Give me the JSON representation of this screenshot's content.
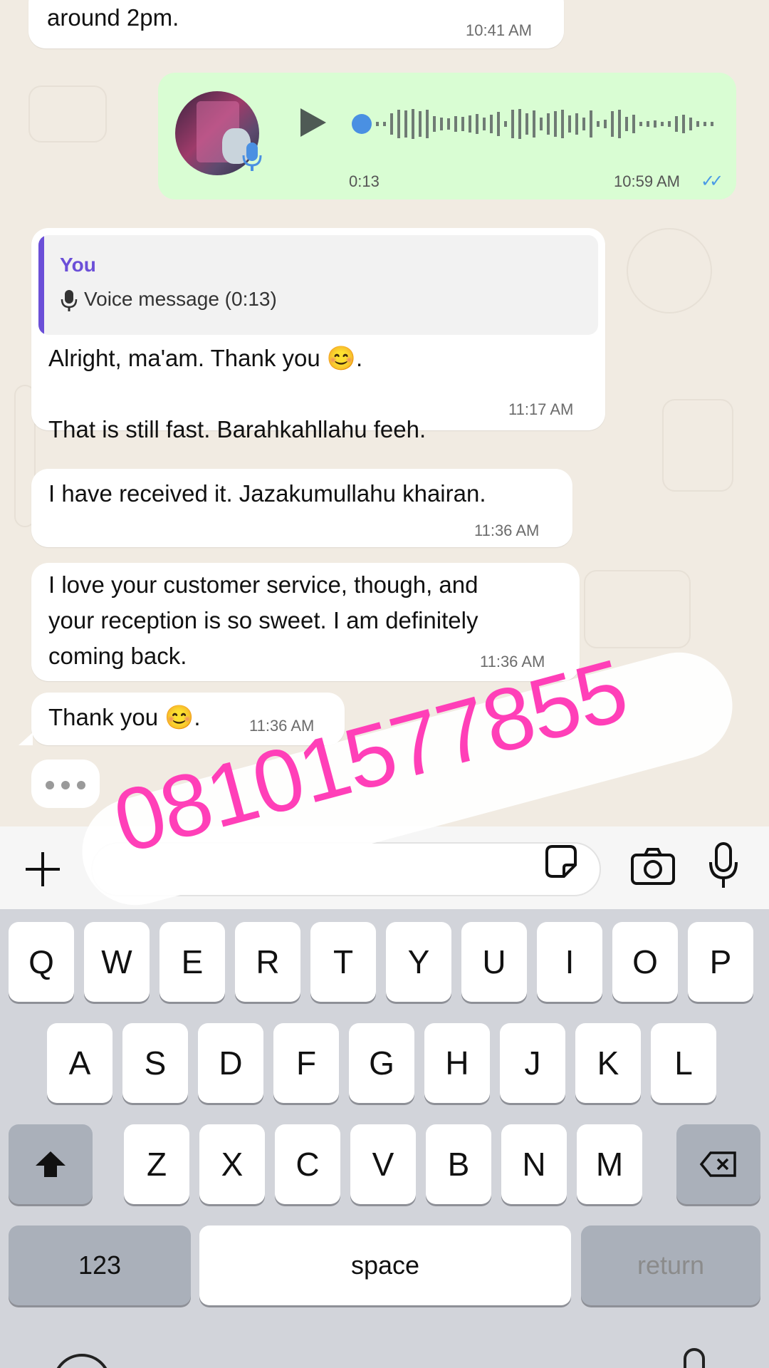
{
  "messages": {
    "m0": {
      "text": "around 2pm.",
      "time": "10:41 AM"
    },
    "voice": {
      "duration": "0:13",
      "time": "10:59 AM",
      "ticks": "✓✓"
    },
    "m1": {
      "quote_author": "You",
      "quote_text": "Voice message (0:13)",
      "text": "Alright, ma'am.  Thank you 😊.\n\nThat is still fast. Barahkahllahu feeh.",
      "time": "11:17 AM"
    },
    "m2": {
      "text": "I have received it. Jazakumullahu khairan.",
      "time": "11:36 AM"
    },
    "m3": {
      "text": "I love your customer service, though, and\nyour reception is so sweet. I am definitely\ncoming back.",
      "time": "11:36 AM"
    },
    "m4": {
      "text": "Thank you 😊.",
      "time": "11:36 AM"
    }
  },
  "input": {
    "value": "",
    "placeholder": ""
  },
  "keyboard": {
    "row1": [
      "Q",
      "W",
      "E",
      "R",
      "T",
      "Y",
      "U",
      "I",
      "O",
      "P"
    ],
    "row2": [
      "A",
      "S",
      "D",
      "F",
      "G",
      "H",
      "J",
      "K",
      "L"
    ],
    "row3": [
      "Z",
      "X",
      "C",
      "V",
      "B",
      "N",
      "M"
    ],
    "numbers": "123",
    "space": "space",
    "return": "return"
  },
  "watermark": {
    "text": "08101577855"
  },
  "colors": {
    "outgoing_bubble": "#d9fdd3",
    "quote_accent": "#6b4fd8",
    "read_ticks": "#4a9ae6",
    "watermark": "#ff3fb8"
  }
}
